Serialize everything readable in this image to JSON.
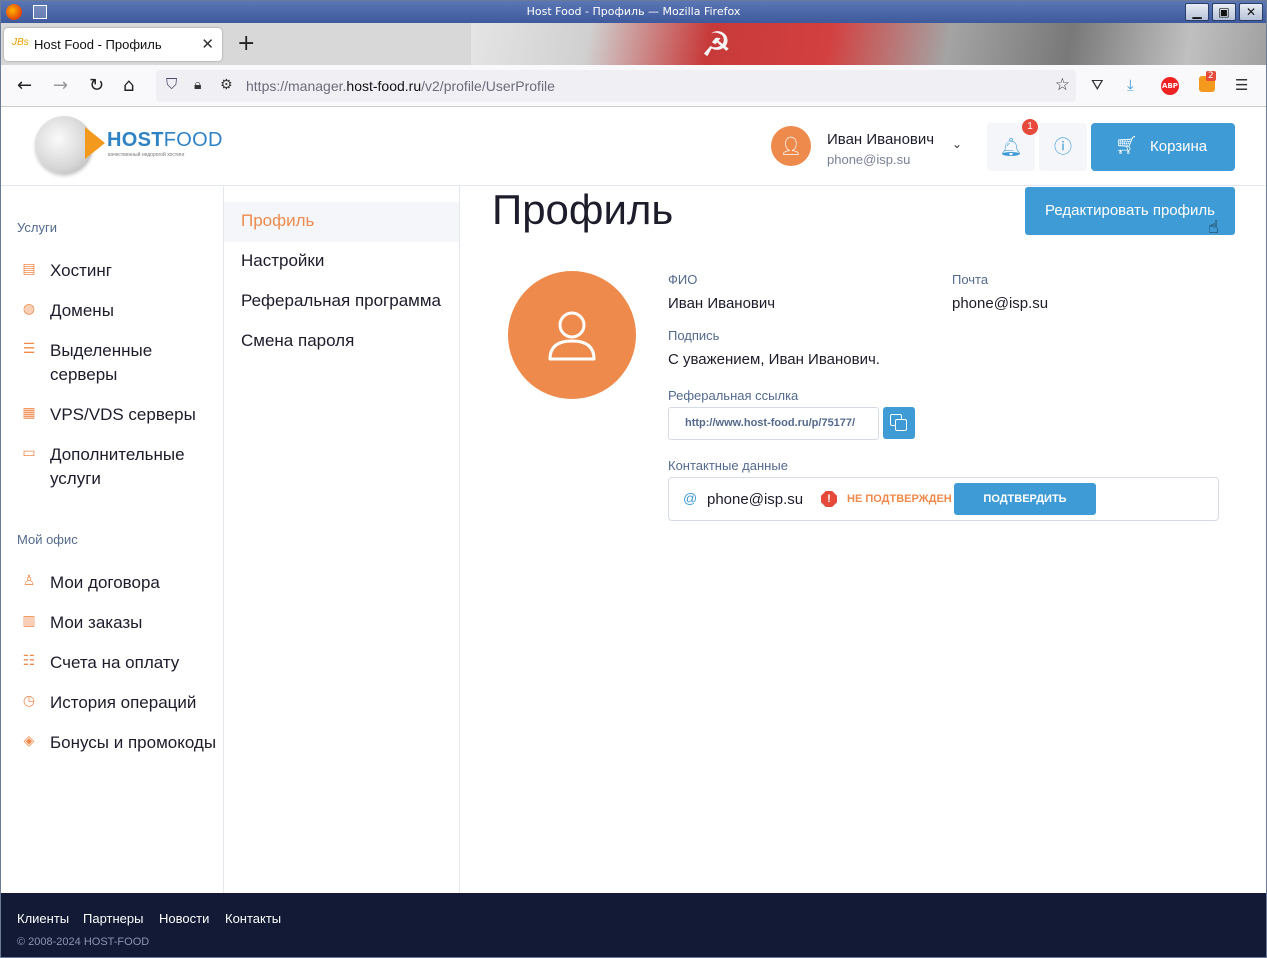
{
  "window": {
    "title": "Host Food - Профиль — Mozilla Firefox",
    "buttons": {
      "minimize": "▁",
      "maximize": "▣",
      "close": "✕"
    }
  },
  "browser": {
    "tab_title": "Host Food - Профиль",
    "tab_favicon_text": "JBs",
    "url_prefix": "https://manager.",
    "url_host": "host-food.ru",
    "url_path": "/v2/profile/UserProfile",
    "icons": [
      "back-icon",
      "forward-icon",
      "reload-icon",
      "home-icon",
      "shield-icon",
      "lock-icon",
      "bookmark-star-icon",
      "pocket-icon",
      "downloads-icon",
      "adblock-icon",
      "extension-icon",
      "menu-icon"
    ],
    "extension_badge": "2",
    "adblock_label": "ABP"
  },
  "header": {
    "logo_host": "HOST",
    "logo_food": "FOOD",
    "logo_tagline": "качественный недорогой хостинг",
    "user_name": "Иван Иванович",
    "user_email": "phone@isp.su",
    "notification_count": "1",
    "cart_label": "Корзина"
  },
  "sidebar": {
    "services_title": "Услуги",
    "services": [
      {
        "label": "Хостинг",
        "icon": "server-icon"
      },
      {
        "label": "Домены",
        "icon": "globe-icon"
      },
      {
        "label": "Выделенные серверы",
        "icon": "dedicated-server-icon"
      },
      {
        "label": "VPS/VDS серверы",
        "icon": "vps-icon"
      },
      {
        "label": "Дополнительные услуги",
        "icon": "addon-icon"
      }
    ],
    "office_title": "Мой офис",
    "office": [
      {
        "label": "Мои договора",
        "icon": "contract-icon"
      },
      {
        "label": "Мои заказы",
        "icon": "orders-icon"
      },
      {
        "label": "Счета на оплату",
        "icon": "invoice-icon"
      },
      {
        "label": "История операций",
        "icon": "history-icon"
      },
      {
        "label": "Бонусы и промокоды",
        "icon": "tag-icon"
      }
    ]
  },
  "submenu": {
    "items": [
      "Профиль",
      "Настройки",
      "Реферальная программа",
      "Смена пароля"
    ],
    "active": "Профиль"
  },
  "profile": {
    "page_title": "Профиль",
    "edit_button": "Редактировать профиль",
    "fio_label": "ФИО",
    "fio_value": "Иван Иванович",
    "email_label": "Почта",
    "email_value": "phone@isp.su",
    "signature_label": "Подпись",
    "signature_value": "С уважением, Иван Иванович.",
    "referral_label": "Реферальная ссылка",
    "referral_value": "http://www.host-food.ru/p/75177/",
    "contacts_label": "Контактные данные",
    "contact_email": "phone@isp.su",
    "contact_status": "НЕ ПОДТВЕРЖДЕН",
    "confirm_button": "ПОДТВЕРДИТЬ"
  },
  "footer": {
    "links": [
      "Клиенты",
      "Партнеры",
      "Новости",
      "Контакты"
    ],
    "copyright": "© 2008-2024 HOST-FOOD"
  },
  "colors": {
    "accent": "#3f9bd5",
    "orange": "#ee8a4c",
    "footer_bg": "#121a35",
    "label": "#546a8c"
  }
}
